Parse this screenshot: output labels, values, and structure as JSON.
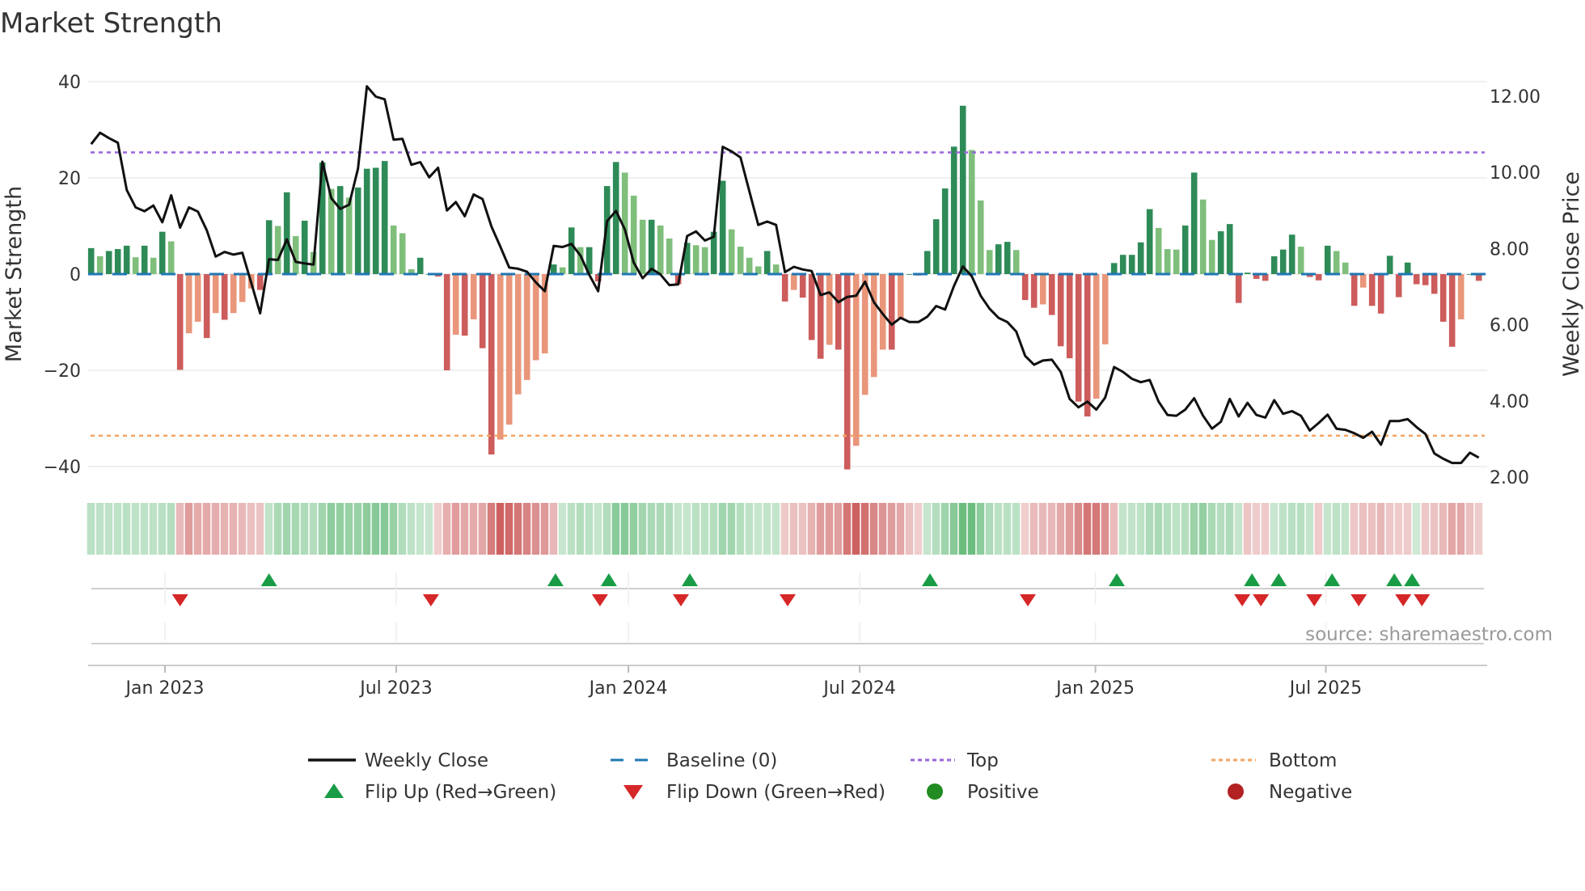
{
  "chart_data": {
    "type": "bar+line",
    "title": "Market Strength",
    "ylabel": "Market Strength",
    "y2label": "Weekly Close Price",
    "ylim": [
      -40,
      40
    ],
    "y2lim": [
      2,
      12
    ],
    "yticks": [
      "40",
      "20",
      "0",
      "−20",
      "−40"
    ],
    "ytick_values": [
      40,
      20,
      0,
      -20,
      -40
    ],
    "y2ticks": [
      "12.00",
      "10.00",
      "8.00",
      "6.00",
      "4.00",
      "2.00"
    ],
    "y2tick_values": [
      12,
      10,
      8,
      6,
      4,
      2
    ],
    "xticks": [
      "Jan 2023",
      "Jul 2023",
      "Jan 2024",
      "Jul 2024",
      "Jan 2025",
      "Jul 2025"
    ],
    "xtick_week_index": [
      8.3,
      34.3,
      60.4,
      86.4,
      112.9,
      138.8
    ],
    "frequency": "weekly",
    "top_level": 25.3,
    "bottom_level": -33.6,
    "baseline": 0,
    "strength": [
      5.4,
      3.7,
      4.8,
      5.2,
      5.9,
      3.5,
      5.9,
      3.4,
      8.8,
      6.8,
      -19.9,
      -12.3,
      -9.9,
      -13.3,
      -8.1,
      -9.5,
      -8.1,
      -5.8,
      -3,
      -3.3,
      11.2,
      10,
      17,
      7.9,
      11.1,
      4.6,
      23.2,
      17.7,
      18.3,
      15.9,
      18,
      21.9,
      22.1,
      23.5,
      10.1,
      8.5,
      1,
      3.4,
      0,
      -0.5,
      -20,
      -12.6,
      -12.8,
      -9.4,
      -15.4,
      -37.5,
      -34.4,
      -31.3,
      -25,
      -22,
      -17.9,
      -16.5,
      2,
      1.4,
      9.7,
      5.6,
      5.6,
      -1.5,
      18.3,
      23.3,
      21.1,
      16.3,
      11.3,
      11.3,
      10.1,
      7.4,
      -2.1,
      6.5,
      6,
      5.6,
      8.8,
      19.4,
      9.3,
      5.7,
      3.4,
      1.6,
      4.8,
      2,
      -5.7,
      -3.3,
      -4.9,
      -13.7,
      -17.6,
      -14.7,
      -15.7,
      -40.6,
      -35.7,
      -25.1,
      -21.4,
      -15.7,
      -15.7,
      -9.2,
      0,
      -0.3,
      4.8,
      11.4,
      17.8,
      26.5,
      35,
      25.8,
      15.3,
      5,
      6.2,
      6.7,
      5,
      -5.4,
      -7,
      -6.3,
      -8.5,
      -15,
      -17.5,
      -26.5,
      -29.6,
      -25.9,
      -14.6,
      2.3,
      4,
      4,
      6.6,
      13.5,
      9.6,
      5.2,
      5.1,
      10.1,
      21.1,
      15.5,
      7.1,
      8.9,
      10.4,
      -6,
      0.3,
      -1,
      -1.4,
      3.7,
      5.1,
      8.2,
      5.7,
      -0.6,
      -1.3,
      5.9,
      4.8,
      2.4,
      -6.6,
      -2.8,
      -6.6,
      -8.2,
      3.8,
      -4.8,
      2.4,
      -2.1,
      -2.3,
      -4.1,
      -9.9,
      -15.1,
      -9.4,
      0,
      -1.4
    ],
    "weekly_close": [
      10.74,
      11.04,
      10.9,
      10.78,
      9.54,
      9.08,
      8.98,
      9.13,
      8.69,
      9.4,
      8.55,
      9.08,
      8.97,
      8.48,
      7.79,
      7.91,
      7.84,
      7.89,
      7.1,
      6.3,
      7.72,
      7.7,
      8.24,
      7.65,
      7.61,
      7.58,
      10.28,
      9.32,
      9.04,
      9.15,
      10.1,
      12.26,
      11.99,
      11.92,
      10.86,
      10.88,
      10.2,
      10.27,
      9.87,
      10.12,
      9.0,
      9.22,
      8.85,
      9.42,
      9.3,
      8.58,
      8.05,
      7.5,
      7.47,
      7.39,
      7.11,
      6.88,
      8.07,
      8.04,
      8.12,
      7.82,
      7.31,
      6.88,
      8.72,
      8.99,
      8.5,
      7.63,
      7.22,
      7.47,
      7.32,
      7.04,
      7.06,
      8.33,
      8.45,
      8.21,
      8.31,
      10.67,
      10.55,
      10.39,
      9.5,
      8.62,
      8.71,
      8.62,
      7.38,
      7.52,
      7.45,
      7.41,
      6.78,
      6.85,
      6.59,
      6.73,
      6.76,
      7.13,
      6.59,
      6.28,
      6.0,
      6.18,
      6.07,
      6.07,
      6.21,
      6.49,
      6.4,
      7.02,
      7.53,
      7.27,
      6.76,
      6.42,
      6.18,
      6.07,
      5.82,
      5.18,
      4.95,
      5.06,
      5.08,
      4.76,
      4.05,
      3.83,
      3.98,
      3.77,
      4.09,
      4.89,
      4.76,
      4.58,
      4.49,
      4.55,
      3.98,
      3.63,
      3.61,
      3.77,
      4.07,
      3.61,
      3.27,
      3.45,
      4.05,
      3.59,
      3.95,
      3.63,
      3.56,
      4.02,
      3.66,
      3.73,
      3.61,
      3.22,
      3.42,
      3.64,
      3.27,
      3.24,
      3.15,
      3.03,
      3.19,
      2.85,
      3.47,
      3.47,
      3.52,
      3.31,
      3.13,
      2.62,
      2.48,
      2.37,
      2.37,
      2.64,
      2.51
    ],
    "flip_up_week_index": [
      20,
      52.2,
      58.2,
      67.3,
      94.3,
      115.3,
      130.5,
      133.5,
      139.5,
      146.5,
      148.5
    ],
    "flip_down_week_index": [
      10,
      38.2,
      57.2,
      66.3,
      78.3,
      105.3,
      129.4,
      131.5,
      137.5,
      142.5,
      147.5,
      149.6
    ],
    "legend": [
      {
        "label": "Weekly Close",
        "kind": "line",
        "color": "#111111"
      },
      {
        "label": "Baseline (0)",
        "kind": "dash",
        "color": "#1f77b4"
      },
      {
        "label": "Top",
        "kind": "dot",
        "color": "#9966dd"
      },
      {
        "label": "Bottom",
        "kind": "dot",
        "color": "#f4a460"
      },
      {
        "label": "Flip Up (Red→Green)",
        "kind": "triangle-up",
        "color": "#1a9c47"
      },
      {
        "label": "Flip Down (Green→Red)",
        "kind": "triangle-down",
        "color": "#d62728"
      },
      {
        "label": "Positive",
        "kind": "circle",
        "color": "#228b22"
      },
      {
        "label": "Negative",
        "kind": "circle",
        "color": "#b22222"
      }
    ],
    "legend_position": "bottom",
    "colors": {
      "pos_strong": "#2e8b57",
      "pos_weak": "#7fbf7b",
      "neg_strong": "#cd5c5c",
      "neg_weak": "#e9967a"
    },
    "source": "source: sharemaestro.com"
  }
}
